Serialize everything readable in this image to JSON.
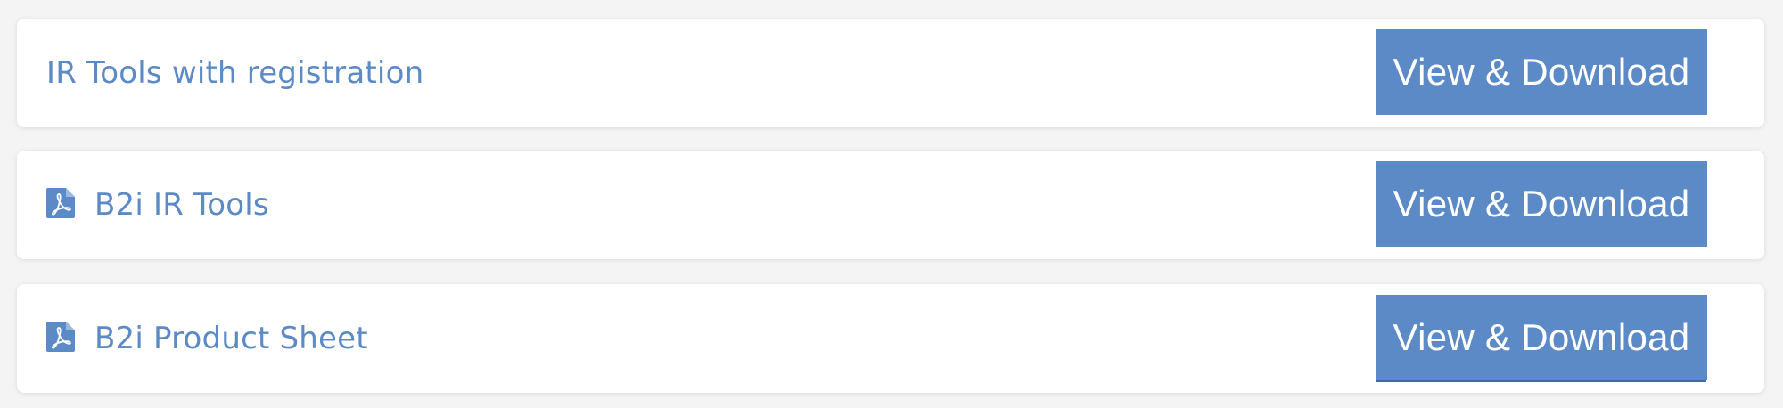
{
  "documents": [
    {
      "label": "IR Tools with registration",
      "icon": "",
      "button_label": "View & Download"
    },
    {
      "label": "B2i IR Tools",
      "icon": "pdf-file-icon",
      "button_label": "View & Download"
    },
    {
      "label": "B2i Product Sheet",
      "icon": "pdf-file-icon",
      "button_label": "View & Download"
    }
  ],
  "colors": {
    "accent": "#5b8ac6",
    "card_background": "#ffffff",
    "page_background": "#f4f4f4"
  }
}
